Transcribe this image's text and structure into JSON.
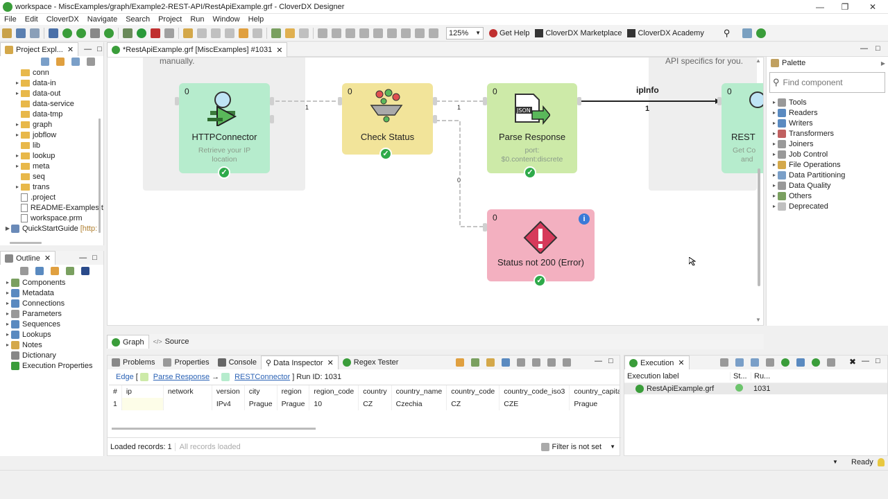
{
  "window": {
    "title": "workspace - MiscExamples/graph/Example2-REST-API/RestApiExample.grf - CloverDX Designer"
  },
  "menu": [
    "File",
    "Edit",
    "CloverDX",
    "Navigate",
    "Search",
    "Project",
    "Run",
    "Window",
    "Help"
  ],
  "toolbar": {
    "zoom": "125%",
    "get_help": "Get Help",
    "marketplace": "CloverDX Marketplace",
    "academy": "CloverDX Academy"
  },
  "project_explorer": {
    "tab_label": "Project Expl...",
    "items": [
      {
        "label": "conn",
        "type": "folder",
        "expandable": false
      },
      {
        "label": "data-in",
        "type": "folder",
        "expandable": true
      },
      {
        "label": "data-out",
        "type": "folder",
        "expandable": true
      },
      {
        "label": "data-service",
        "type": "folder",
        "expandable": false
      },
      {
        "label": "data-tmp",
        "type": "folder",
        "expandable": false
      },
      {
        "label": "graph",
        "type": "folder",
        "expandable": true
      },
      {
        "label": "jobflow",
        "type": "folder",
        "expandable": true
      },
      {
        "label": "lib",
        "type": "folder",
        "expandable": false
      },
      {
        "label": "lookup",
        "type": "folder",
        "expandable": true
      },
      {
        "label": "meta",
        "type": "folder",
        "expandable": true
      },
      {
        "label": "seq",
        "type": "folder",
        "expandable": false
      },
      {
        "label": "trans",
        "type": "folder",
        "expandable": true
      },
      {
        "label": ".project",
        "type": "file",
        "expandable": false
      },
      {
        "label": "README-Examples.t",
        "type": "file",
        "expandable": false
      },
      {
        "label": "workspace.prm",
        "type": "file",
        "expandable": false
      }
    ],
    "quickstart": "QuickStartGuide",
    "quickstart_suffix": "[http:"
  },
  "outline": {
    "tab_label": "Outline",
    "items": [
      "Components",
      "Metadata",
      "Connections",
      "Parameters",
      "Sequences",
      "Lookups",
      "Notes",
      "Dictionary",
      "Execution Properties"
    ]
  },
  "editor": {
    "tab_label": "*RestApiExample.grf [MiscExamples] #1031",
    "note_left": "manually.",
    "note_right": "API specifics for you.",
    "nodes": {
      "http": {
        "count": "0",
        "label": "HTTPConnector",
        "desc1": "Retrieve your IP",
        "desc2": "location"
      },
      "check": {
        "count": "0",
        "label": "Check Status"
      },
      "parse": {
        "count": "0",
        "label": "Parse Response",
        "desc1": "port:",
        "desc2": "$0.content:discrete"
      },
      "rest": {
        "count": "0",
        "label": "REST",
        "desc1": "Get Co",
        "desc2": "and"
      },
      "error": {
        "count": "0",
        "label": "Status not 200 (Error)"
      }
    },
    "edges": {
      "e1": "1",
      "e2": "1",
      "e3": "1",
      "e4": "0",
      "ipinfo": "ipInfo"
    },
    "bottom_tabs": {
      "graph": "Graph",
      "source": "Source"
    }
  },
  "palette": {
    "title": "Palette",
    "search_placeholder": "Find component",
    "items": [
      "Tools",
      "Readers",
      "Writers",
      "Transformers",
      "Joiners",
      "Job Control",
      "File Operations",
      "Data Partitioning",
      "Data Quality",
      "Others",
      "Deprecated"
    ]
  },
  "inspector": {
    "tabs": [
      "Problems",
      "Properties",
      "Console",
      "Data Inspector",
      "Regex Tester"
    ],
    "breadcrumb": {
      "edge": "Edge",
      "bracket": "[",
      "from": "Parse Response",
      "arrow": "→",
      "to": "RESTConnector",
      "close": "]",
      "run_id": "Run ID: 1031"
    },
    "columns": [
      "#",
      "ip",
      "network",
      "version",
      "city",
      "region",
      "region_code",
      "country",
      "country_name",
      "country_code",
      "country_code_iso3",
      "country_capital"
    ],
    "rows": [
      [
        "1",
        "",
        "",
        "IPv4",
        "Prague",
        "Prague",
        "10",
        "CZ",
        "Czechia",
        "CZ",
        "CZE",
        "Prague"
      ]
    ],
    "loaded": "Loaded records: 1",
    "all_loaded": "All records loaded",
    "filter": "Filter is not set"
  },
  "execution": {
    "tab_label": "Execution",
    "col_label": "Execution label",
    "col_status": "St...",
    "col_run": "Ru...",
    "row_label": "RestApiExample.grf",
    "row_run": "1031"
  },
  "status": {
    "ready": "Ready"
  }
}
